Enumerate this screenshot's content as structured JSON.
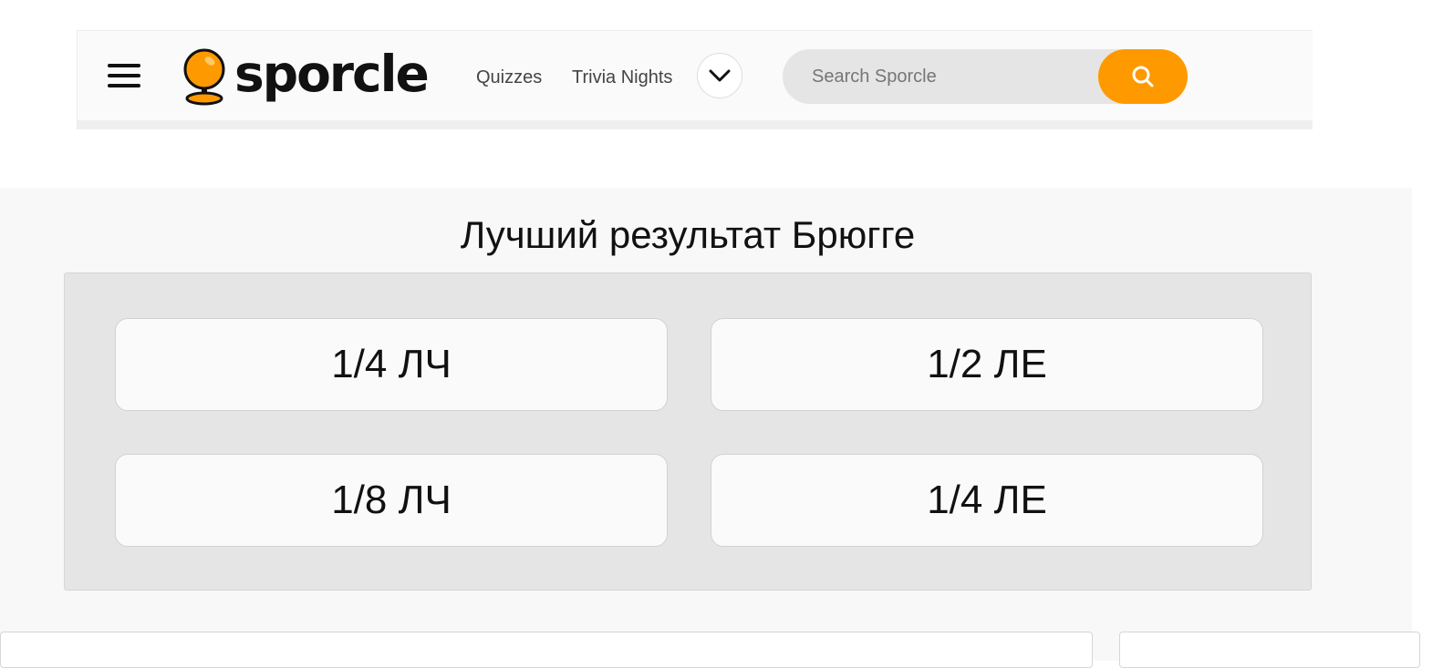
{
  "header": {
    "logo_text": "sporcle",
    "nav": {
      "quizzes_label": "Quizzes",
      "trivia_nights_label": "Trivia Nights"
    },
    "search": {
      "placeholder": "Search Sporcle"
    },
    "icons": {
      "menu": "hamburger-menu-icon",
      "more": "chevron-down-icon",
      "search": "search-icon",
      "logo": "sporcle-globe-logo"
    }
  },
  "quiz": {
    "title": "Лучший результат Брюгге",
    "choices": [
      {
        "label": "1/4 ЛЧ"
      },
      {
        "label": "1/2 ЛЕ"
      },
      {
        "label": "1/8 ЛЧ"
      },
      {
        "label": "1/4 ЛЕ"
      }
    ]
  },
  "colors": {
    "accent": "#ff9900",
    "panel": "#e5e5e5",
    "background": "#f8f8f8",
    "text": "#111111"
  }
}
